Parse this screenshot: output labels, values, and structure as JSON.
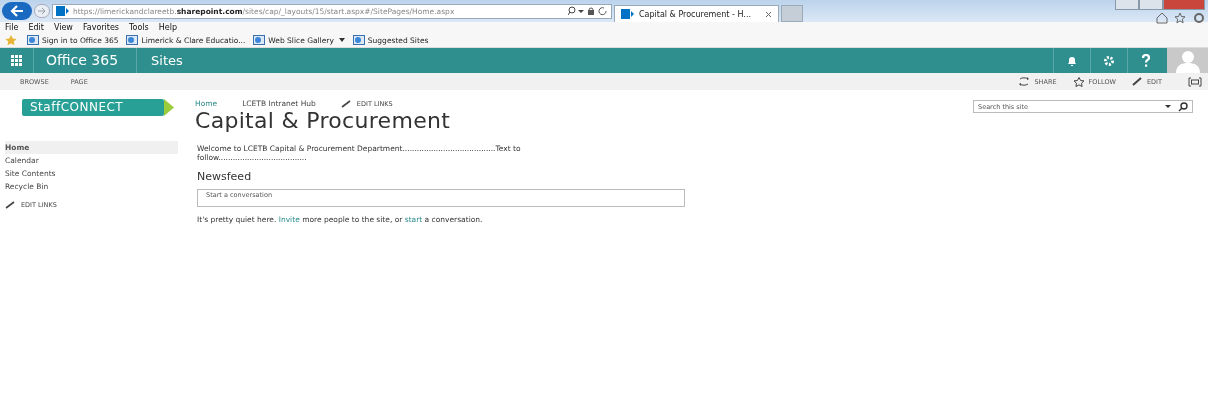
{
  "browser": {
    "url_prefix": "https://limerickandclareetb.",
    "url_domain": "sharepoint.com",
    "url_path": "/sites/cap/_layouts/15/start.aspx#/SitePages/Home.aspx",
    "tabs": [
      {
        "label": "Capital & Procurement - H...",
        "selected": true
      }
    ],
    "menu": [
      "File",
      "Edit",
      "View",
      "Favorites",
      "Tools",
      "Help"
    ],
    "favorites": [
      {
        "label": "Sign in to Office 365",
        "dropdown": false
      },
      {
        "label": "Limerick & Clare Educatio...",
        "dropdown": false
      },
      {
        "label": "Web Slice Gallery",
        "dropdown": true
      },
      {
        "label": "Suggested Sites",
        "dropdown": false
      }
    ]
  },
  "suite_bar": {
    "brand": "Office 365",
    "app": "Sites"
  },
  "ribbon": {
    "tabs": [
      "BROWSE",
      "PAGE"
    ],
    "actions": [
      {
        "kind": "share",
        "label": "SHARE"
      },
      {
        "kind": "follow",
        "label": "FOLLOW"
      },
      {
        "kind": "edit",
        "label": "EDIT"
      }
    ]
  },
  "logo": "StaffCONNECT",
  "quick_launch": {
    "items": [
      {
        "label": "Home",
        "selected": true
      },
      {
        "label": "Calendar",
        "selected": false
      },
      {
        "label": "Site Contents",
        "selected": false
      },
      {
        "label": "Recycle Bin",
        "selected": false
      }
    ],
    "edit_links": "EDIT LINKS"
  },
  "breadcrumbs": [
    {
      "label": "Home",
      "selected": true
    },
    {
      "label": "LCETB Intranet Hub",
      "selected": false
    }
  ],
  "edit_links": "EDIT LINKS",
  "page_title": "Capital & Procurement",
  "search": {
    "placeholder": "Search this site"
  },
  "welcome": "Welcome to LCETB Capital & Procurement Department.......................................Text to follow.....................................",
  "newsfeed": {
    "heading": "Newsfeed",
    "placeholder": "Start a conversation",
    "quiet": [
      {
        "text": "It's pretty quiet here. ",
        "link": false
      },
      {
        "text": "Invite",
        "link": true
      },
      {
        "text": " more people to the site, or ",
        "link": false
      },
      {
        "text": "start",
        "link": true
      },
      {
        "text": " a conversation.",
        "link": false
      }
    ]
  }
}
